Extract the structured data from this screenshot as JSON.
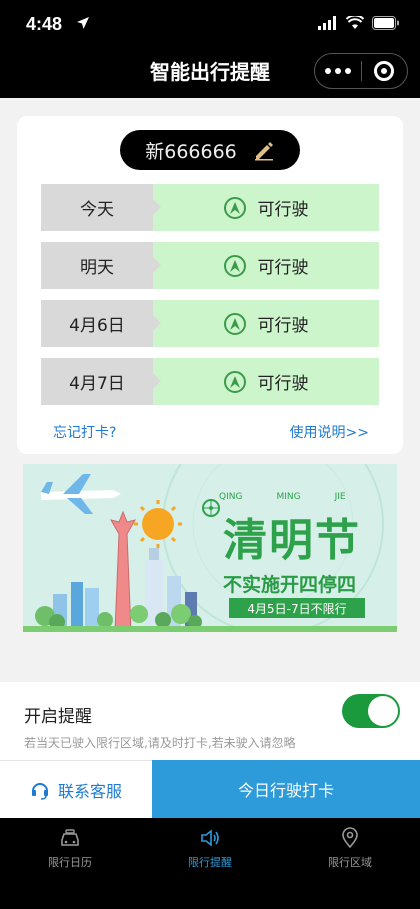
{
  "status_bar": {
    "time": "4:48"
  },
  "nav": {
    "title": "智能出行提醒"
  },
  "card": {
    "plate": "新666666",
    "rows": [
      {
        "day": "今天",
        "status": "可行驶"
      },
      {
        "day": "明天",
        "status": "可行驶"
      },
      {
        "day": "4月6日",
        "status": "可行驶"
      },
      {
        "day": "4月7日",
        "status": "可行驶"
      }
    ],
    "forgot_link": "忘记打卡?",
    "usage_link": "使用说明>>"
  },
  "banner": {
    "headline": "清明节",
    "pinyin": [
      "QING",
      "MING",
      "JIE"
    ],
    "subhead": "不实施开四停四",
    "dates": "4月5日-7日不限行"
  },
  "reminder": {
    "title": "开启提醒",
    "description": "若当天已驶入限行区域,请及时打卡,若未驶入请忽略",
    "enabled": true
  },
  "actions": {
    "contact_label": "联系客服",
    "checkin_label": "今日行驶打卡"
  },
  "tabs": [
    {
      "label": "限行日历",
      "icon": "car-icon",
      "active": false
    },
    {
      "label": "限行提醒",
      "icon": "speaker-icon",
      "active": true
    },
    {
      "label": "限行区域",
      "icon": "location-pin-icon",
      "active": false
    }
  ],
  "colors": {
    "accent_blue": "#2d9ad9",
    "status_green": "#ccf5cc",
    "toggle_green": "#1a9a3d",
    "banner_green": "#2ea14b"
  }
}
